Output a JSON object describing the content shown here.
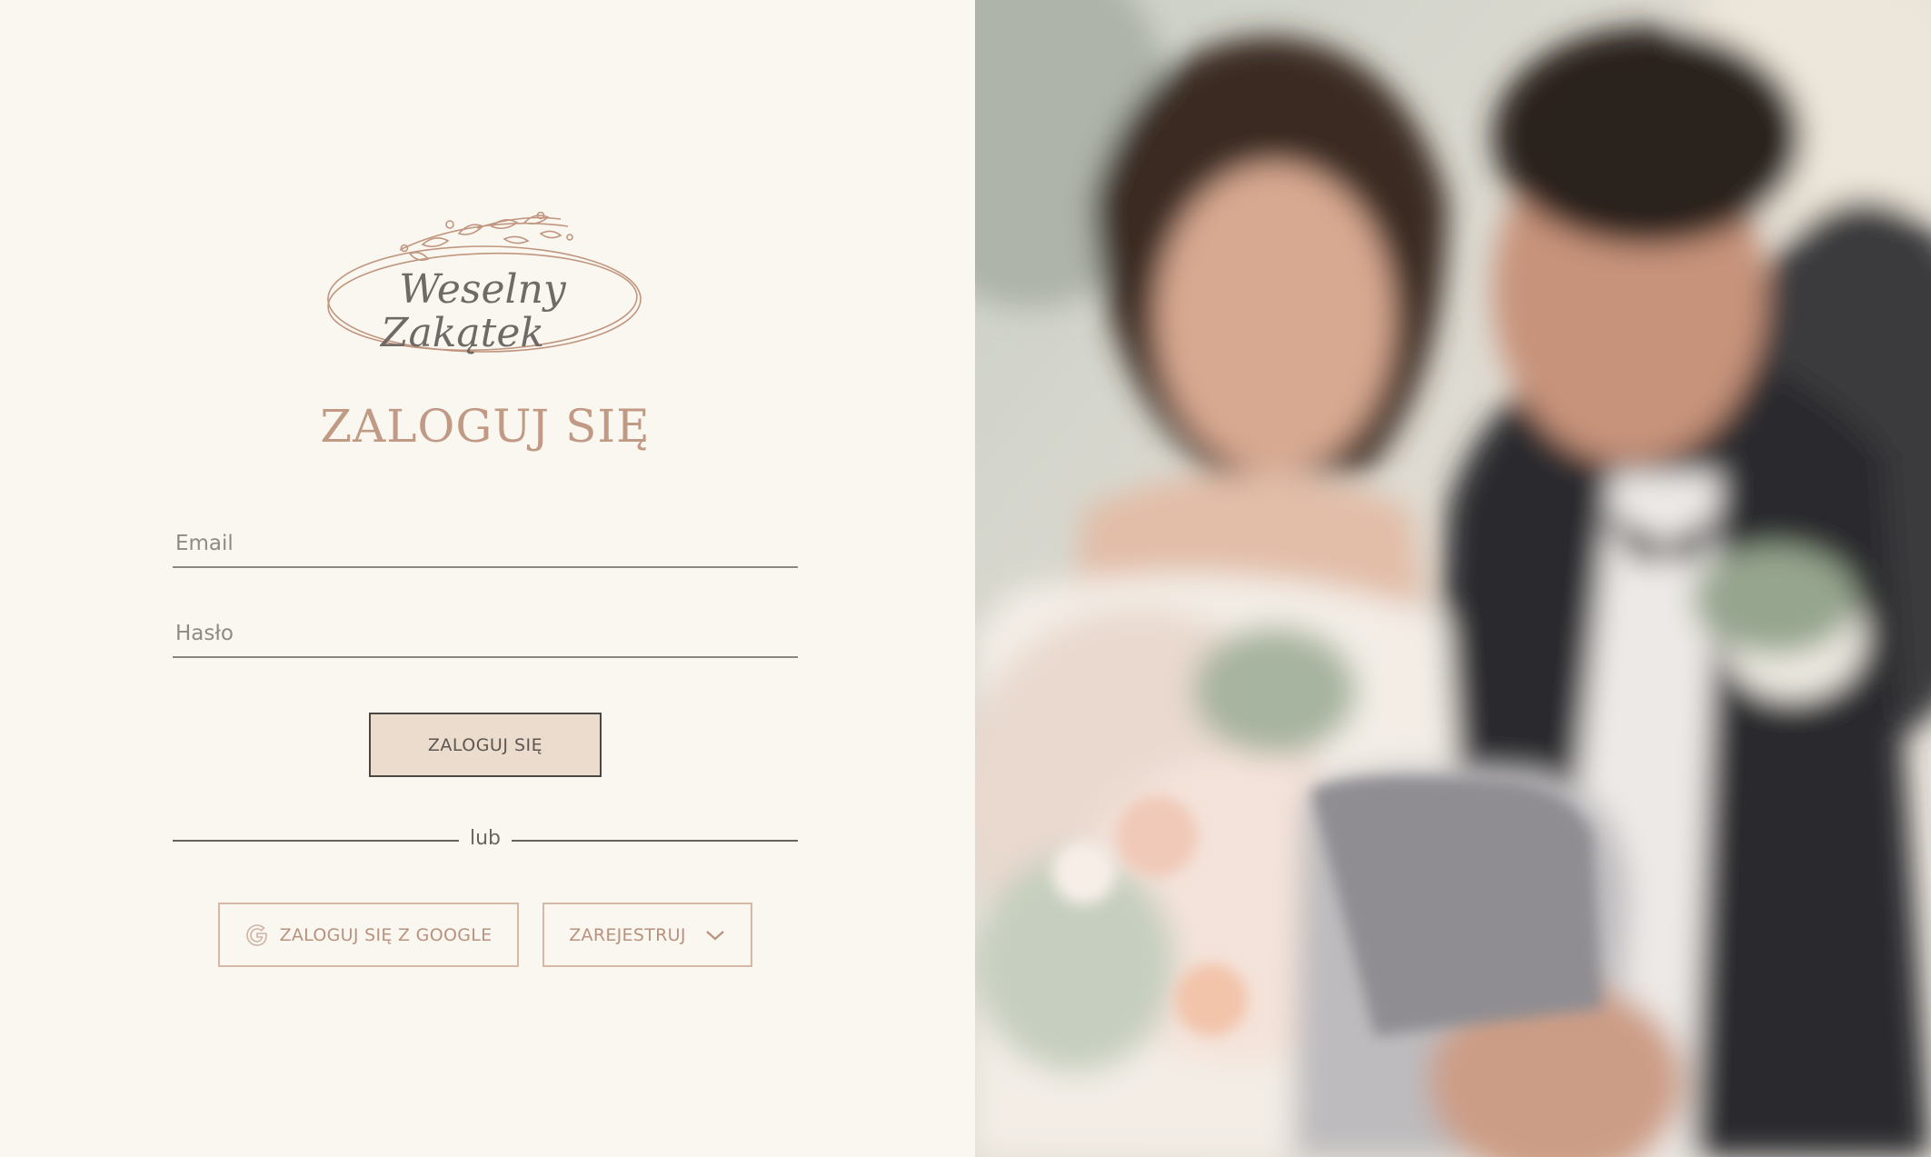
{
  "logo": {
    "text": "Weselny Zakątek",
    "line1": "Weselny",
    "line2": "Zakątek"
  },
  "page": {
    "title": "ZALOGUJ SIĘ"
  },
  "form": {
    "email_placeholder": "Email",
    "email_value": "",
    "password_placeholder": "Hasło",
    "password_value": "",
    "submit_label": "ZALOGUJ SIĘ"
  },
  "divider": {
    "text": "lub"
  },
  "alt_actions": {
    "google_label": "ZALOGUJ SIĘ Z GOOGLE",
    "google_icon": "google-icon",
    "register_label": "ZAREJESTRUJ",
    "register_icon": "chevron-down-icon"
  },
  "colors": {
    "background": "#faf7f1",
    "accent": "#c09a84",
    "button_fill": "#ecdccd",
    "border_outline": "#d6b8a6"
  }
}
